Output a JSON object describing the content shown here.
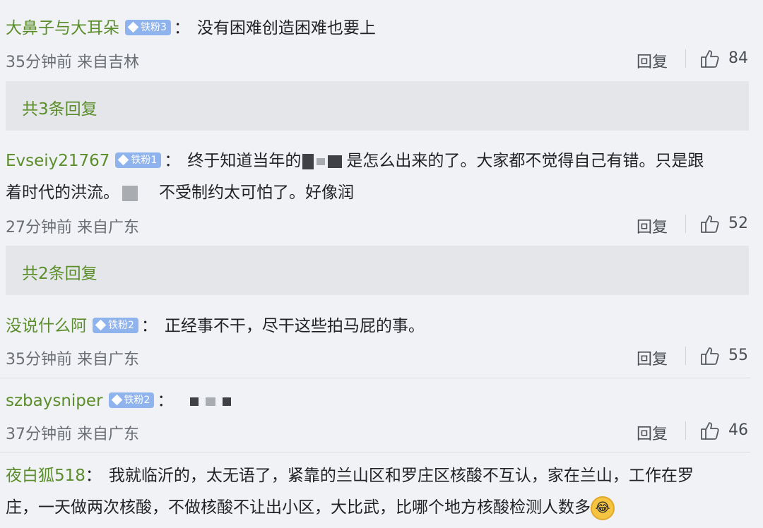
{
  "comments": [
    {
      "user": "大鼻子与大耳朵",
      "badge": "铁粉3",
      "text": "没有困难创造困难也要上",
      "time": "35分钟前",
      "location": "来自吉林",
      "reply": "回复",
      "likes": "84"
    },
    {
      "user": "Evseiy21767",
      "badge": "铁粉1",
      "text_line1a": "终于知道当年的",
      "text_line1b": "是怎么出来的了。大家都不觉得自己有错。只是跟",
      "text_line2a": "着时代的洪流。",
      "text_line2b": "不受制约太可怕了。好像润",
      "time": "27分钟前",
      "location": "来自广东",
      "reply": "回复",
      "likes": "52"
    },
    {
      "user": "没说什么阿",
      "badge": "铁粉2",
      "text": "正经事不干，尽干这些拍马屁的事。",
      "time": "35分钟前",
      "location": "来自广东",
      "reply": "回复",
      "likes": "55"
    },
    {
      "user": "szbaysniper",
      "badge": "铁粉2",
      "text": "",
      "time": "37分钟前",
      "location": "来自广东",
      "reply": "回复",
      "likes": "46"
    },
    {
      "user": "夜白狐518",
      "text_line1": "我就临沂的，太无语了，紧靠的兰山区和罗庄区核酸不互认，家在兰山，工作在罗",
      "text_line2": "庄，一天做两次核酸，不做核酸不让出小区，大比武，比哪个地方核酸检测人数多"
    }
  ],
  "reply_bars": [
    "共3条回复",
    "共2条回复"
  ],
  "colon": "：",
  "icons": {
    "badge": "diamond-icon",
    "like": "thumbs-up-icon",
    "emoji": "laughing-crying-emoji"
  }
}
